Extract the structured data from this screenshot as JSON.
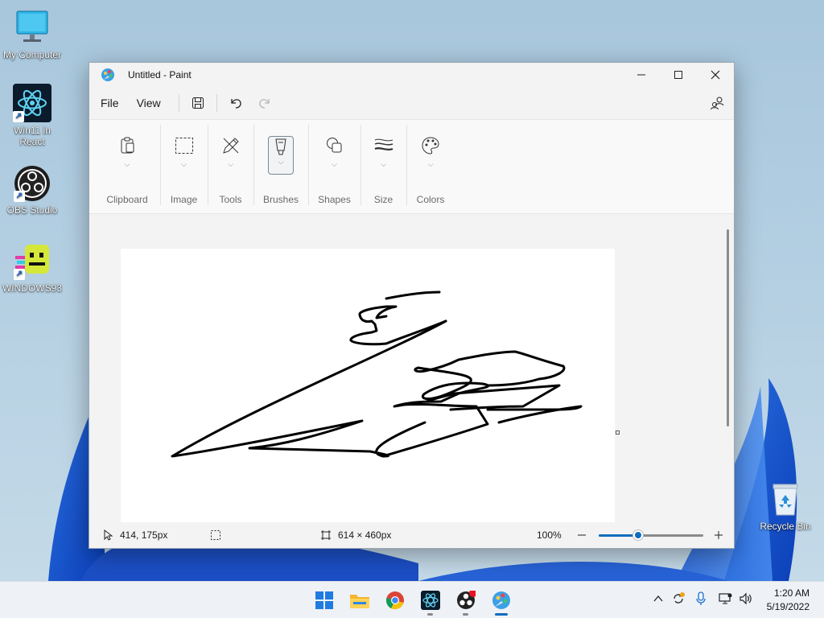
{
  "desktop": {
    "icons": [
      {
        "label": "My Computer",
        "icon": "monitor-icon"
      },
      {
        "label": "Win11 in React",
        "icon": "react-icon"
      },
      {
        "label": "OBS Studio",
        "icon": "obs-icon"
      },
      {
        "label": "WINDOWS93",
        "icon": "windows93-icon"
      },
      {
        "label": "Recycle Bin",
        "icon": "recycle-bin-icon"
      }
    ]
  },
  "window": {
    "title": "Untitled - Paint",
    "icon": "paint-app-icon"
  },
  "menubar": {
    "file_label": "File",
    "view_label": "View",
    "tools": [
      "save-icon",
      "undo-icon",
      "redo-icon"
    ],
    "right_icon": "settings-people-icon"
  },
  "ribbon": {
    "groups": [
      {
        "label": "Clipboard",
        "icon": "clipboard-icon"
      },
      {
        "label": "Image",
        "icon": "selection-icon"
      },
      {
        "label": "Tools",
        "icon": "pencil-icon"
      },
      {
        "label": "Brushes",
        "icon": "brush-icon",
        "active": true
      },
      {
        "label": "Shapes",
        "icon": "shapes-icon"
      },
      {
        "label": "Size",
        "icon": "size-icon"
      },
      {
        "label": "Colors",
        "icon": "palette-icon"
      }
    ]
  },
  "statusbar": {
    "cursor_position": "414, 175px",
    "canvas_size": "614 × 460px",
    "zoom": "100%",
    "zoom_slider_fraction": 0.38
  },
  "taskbar": {
    "apps": [
      "start-icon",
      "file-explorer-icon",
      "chrome-icon",
      "react-icon",
      "obs-icon",
      "paint-icon"
    ],
    "active_app": "paint-icon",
    "clock_time": "1:20 AM",
    "clock_date": "5/19/2022"
  },
  "colors": {
    "accent": "#0f6cbd",
    "window_bg": "#f3f3f3",
    "canvas_bg": "#ffffff",
    "stroke": "#000000"
  }
}
